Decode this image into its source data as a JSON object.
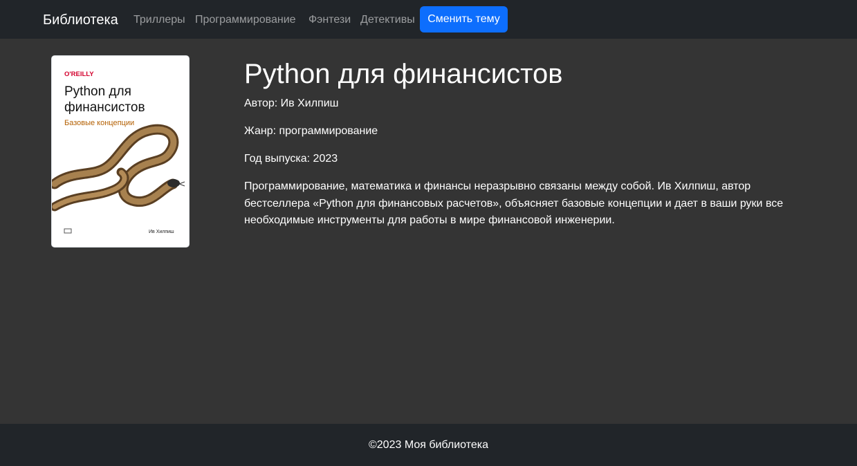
{
  "navbar": {
    "brand": "Библиотека",
    "links": [
      "Триллеры",
      "Программирование",
      "Фэнтези",
      "Детективы"
    ],
    "theme_button": "Сменить тему"
  },
  "book": {
    "cover": {
      "publisher": "O'REILLY",
      "title_line1": "Python для",
      "title_line2": "финансистов",
      "subtitle": "Базовые концепции",
      "author": "Ив Хилпиш"
    },
    "title": "Python для финансистов",
    "author_line": "Автор: Ив Хилпиш",
    "genre_line": "Жанр: программирование",
    "year_line": "Год выпуска: 2023",
    "description": "Программирование, математика и финансы неразрывно связаны между собой. Ив Хилпиш, автор бестселлера «Python для финансовых расчетов», объясняет базовые концепции и дает в ваши руки все необходимые инструменты для работы в мире финансовой инженерии."
  },
  "footer": {
    "text": "©2023 Моя библиотека"
  },
  "colors": {
    "navbar_bg": "#212529",
    "page_bg": "#343434",
    "accent": "#0d6efd",
    "publisher_red": "#d3002d",
    "subtitle_orange": "#b35f00"
  }
}
